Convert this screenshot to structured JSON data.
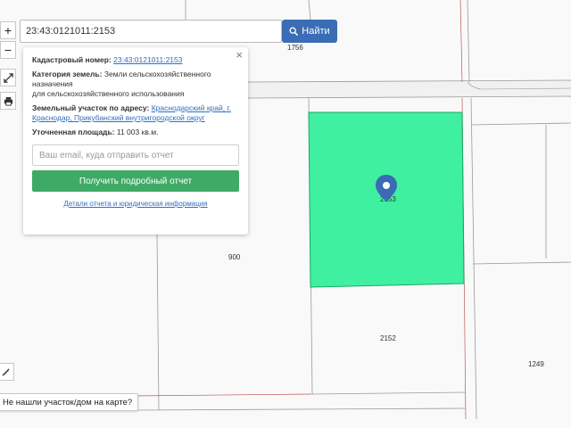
{
  "search": {
    "value": "23:43:0121011:2153",
    "placeholder": "",
    "button_label": "Найти",
    "button_icon": "search-icon"
  },
  "controls": {
    "zoom_in": "+",
    "zoom_out": "−",
    "fullscreen_icon": "expand-icon",
    "print_icon": "printer-icon",
    "ruler_icon": "ruler-icon"
  },
  "map": {
    "plot_labels": [
      "1756",
      "900",
      "2152",
      "1249",
      "2153"
    ],
    "highlight_color": "#3ff0a0",
    "pin_color": "#3b6bb5"
  },
  "card": {
    "cadastral_label": "Кадастровый номер:",
    "cadastral_value": "23:43:0121011:2153",
    "category_label": "Категория земель:",
    "category_value": "Земли сельскохозяйственного назначения",
    "category_use": "для сельскохозяйственного использования",
    "address_label": "Земельный участок по адресу:",
    "address_value": "Краснодарский край, г. Краснодар, Прикубанский внутригородской округ",
    "area_label": "Уточненная площадь:",
    "area_value": "11 003 кв.м.",
    "email_placeholder": "Ваш email, куда отправить отчет",
    "report_button": "Получить подробный отчет",
    "details_link": "Детали отчета и юридическая информация",
    "close": "×"
  },
  "not_found": "Не нашли участок/дом на карте?"
}
